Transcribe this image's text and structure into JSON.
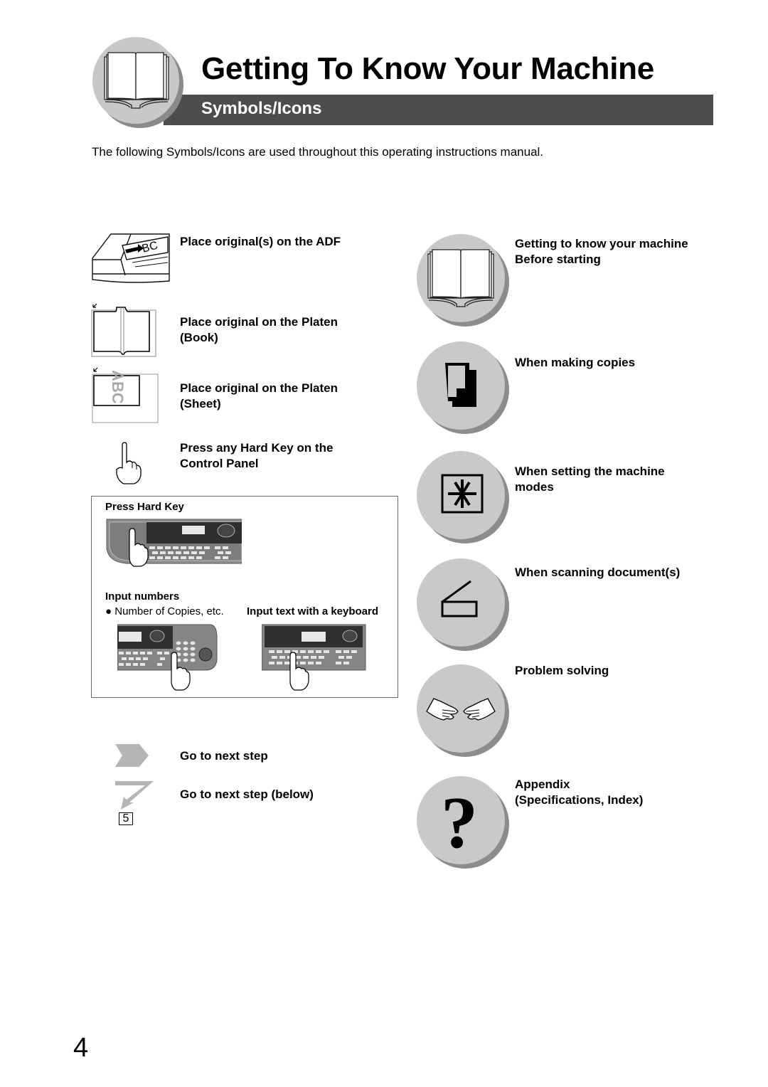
{
  "header": {
    "title": "Getting To Know Your Machine",
    "subtitle": "Symbols/Icons",
    "icon": "open-book-icon",
    "bar_color": "#4d4d4d"
  },
  "intro": "The following Symbols/Icons are used throughout this operating instructions manual.",
  "left_items": [
    {
      "icon": "adf-icon",
      "label": "Place original(s) on the ADF"
    },
    {
      "icon": "platen-book-icon",
      "label_line1": "Place original on the Platen",
      "label_line2": "(Book)"
    },
    {
      "icon": "platen-sheet-icon",
      "label_line1": "Place original on the Platen",
      "label_line2": "(Sheet)"
    },
    {
      "icon": "finger-press-icon",
      "label_line1": "Press any Hard Key on the",
      "label_line2": "Control Panel"
    }
  ],
  "panel_box": {
    "press_hard_key": "Press Hard Key",
    "input_numbers": "Input numbers",
    "number_of_copies": "Number of Copies, etc.",
    "input_text_keyboard": "Input text with a keyboard",
    "bullet": "●"
  },
  "steps": [
    {
      "icon": "next-step-arrow-icon",
      "label": "Go to next step"
    },
    {
      "icon": "next-step-below-arrow-icon",
      "label": "Go to next step (below)",
      "badge": "5"
    }
  ],
  "right_items": [
    {
      "icon": "open-book-icon",
      "label_line1": "Getting to know your machine",
      "label_line2": "Before starting"
    },
    {
      "icon": "copy-icon",
      "label_line1": "When making copies"
    },
    {
      "icon": "asterisk-box-icon",
      "label_line1": "When setting the machine",
      "label_line2": "modes"
    },
    {
      "icon": "scanner-icon",
      "label_line1": "When scanning document(s)"
    },
    {
      "icon": "handshake-icon",
      "label_line1": "Problem solving"
    },
    {
      "icon": "question-mark-icon",
      "label_line1": "Appendix",
      "label_line2": "(Specifications, Index)"
    }
  ],
  "page_number": "4"
}
